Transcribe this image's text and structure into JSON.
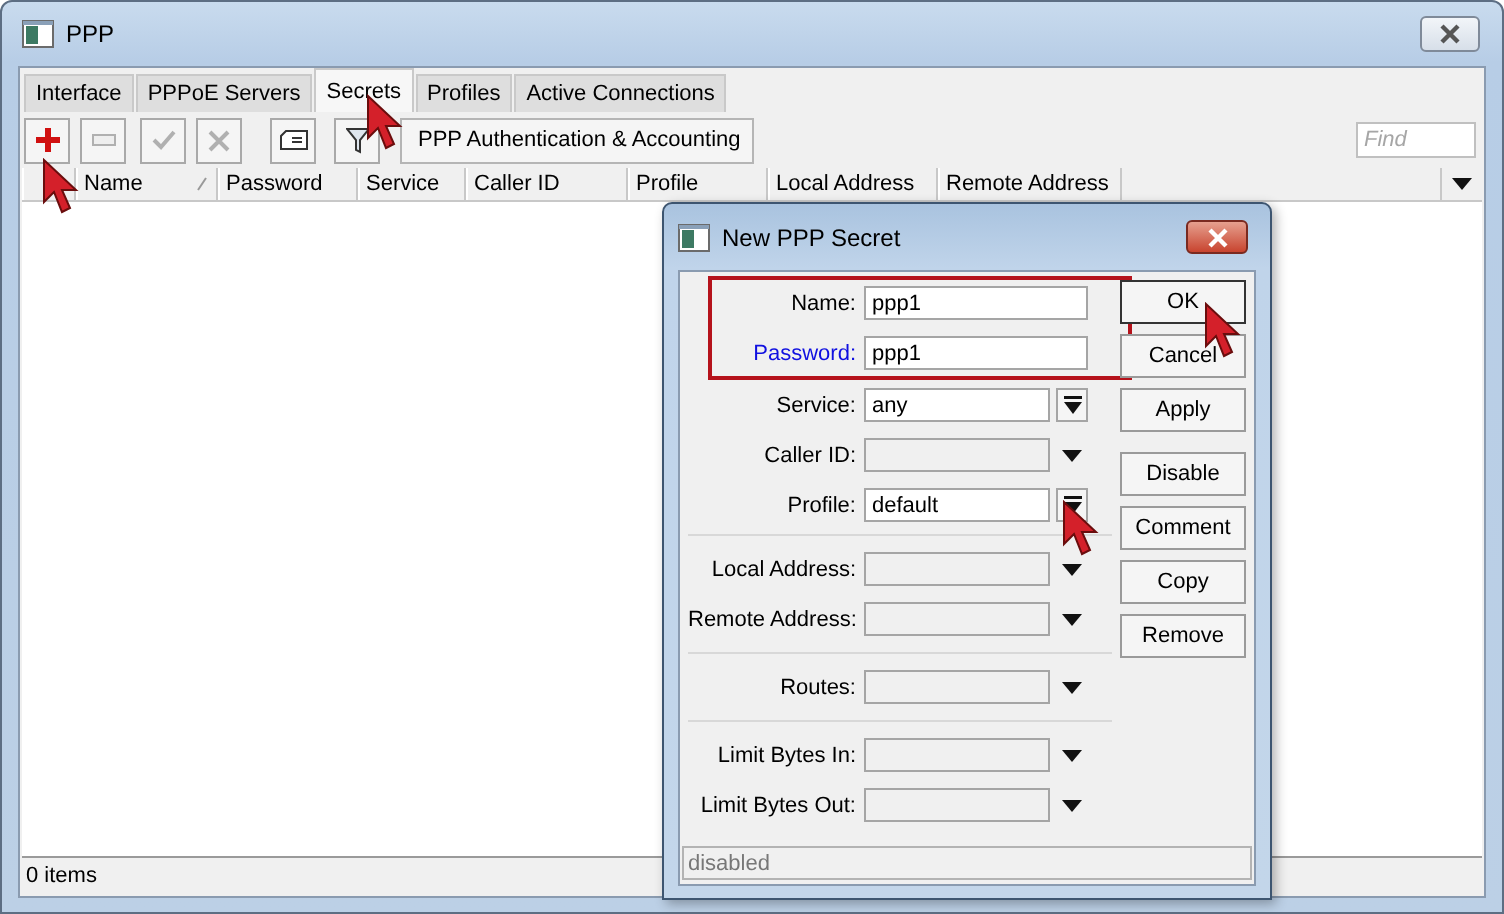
{
  "window": {
    "title": "PPP"
  },
  "tabs": [
    {
      "label": "Interface",
      "selected": false
    },
    {
      "label": "PPPoE Servers",
      "selected": false
    },
    {
      "label": "Secrets",
      "selected": true
    },
    {
      "label": "Profiles",
      "selected": false
    },
    {
      "label": "Active Connections",
      "selected": false
    }
  ],
  "toolbar": {
    "buttons": [
      {
        "kind": "add",
        "disabled": false
      },
      {
        "kind": "remove",
        "disabled": true
      },
      {
        "kind": "enable",
        "disabled": true
      },
      {
        "kind": "disable",
        "disabled": true
      },
      {
        "kind": "comment",
        "disabled": false
      },
      {
        "kind": "filter",
        "disabled": false
      }
    ],
    "auth_button": "PPP Authentication & Accounting",
    "search": {
      "placeholder": "Find"
    }
  },
  "table": {
    "columns": [
      {
        "label": "Name",
        "sorted": true
      },
      {
        "label": "Password",
        "sorted": false
      },
      {
        "label": "Service",
        "sorted": false
      },
      {
        "label": "Caller ID",
        "sorted": false
      },
      {
        "label": "Profile",
        "sorted": false
      },
      {
        "label": "Local Address",
        "sorted": false
      },
      {
        "label": "Remote Address",
        "sorted": false
      }
    ]
  },
  "status_bar": "0 items",
  "dialog": {
    "title": "New PPP Secret",
    "groups": [
      {
        "highlighted": true,
        "separated": false,
        "fields": [
          {
            "label": "Name:",
            "value": "ppp1",
            "kind": "text",
            "emphasized": false
          },
          {
            "label": "Password:",
            "value": "ppp1",
            "kind": "text",
            "emphasized": true
          }
        ]
      },
      {
        "highlighted": false,
        "separated": false,
        "fields": [
          {
            "label": "Service:",
            "value": "any",
            "kind": "select",
            "emphasized": false
          },
          {
            "label": "Caller ID:",
            "kind": "combo",
            "emphasized": false
          },
          {
            "label": "Profile:",
            "value": "default",
            "kind": "select",
            "emphasized": false
          }
        ]
      },
      {
        "highlighted": false,
        "separated": true,
        "fields": [
          {
            "label": "Local Address:",
            "kind": "combo",
            "emphasized": false
          },
          {
            "label": "Remote Address:",
            "kind": "combo",
            "emphasized": false
          }
        ]
      },
      {
        "highlighted": false,
        "separated": true,
        "fields": [
          {
            "label": "Routes:",
            "kind": "combo",
            "emphasized": false
          }
        ]
      },
      {
        "highlighted": false,
        "separated": true,
        "fields": [
          {
            "label": "Limit Bytes In:",
            "kind": "combo",
            "emphasized": false
          },
          {
            "label": "Limit Bytes Out:",
            "kind": "combo",
            "emphasized": false
          }
        ]
      }
    ],
    "button_groups": [
      [
        {
          "label": "OK",
          "default": true
        },
        {
          "label": "Cancel",
          "default": false
        },
        {
          "label": "Apply",
          "default": false
        }
      ],
      [
        {
          "label": "Disable",
          "default": false
        },
        {
          "label": "Comment",
          "default": false
        },
        {
          "label": "Copy",
          "default": false
        },
        {
          "label": "Remove",
          "default": false
        }
      ]
    ],
    "status": "disabled"
  }
}
